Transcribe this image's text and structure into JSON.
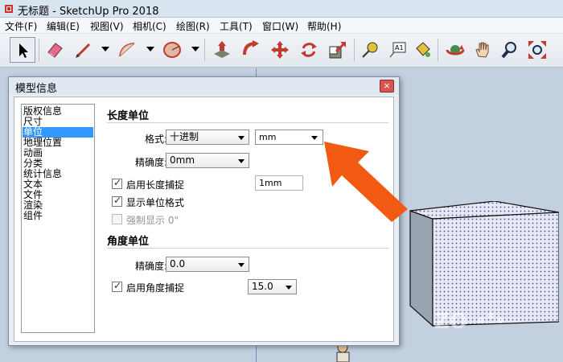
{
  "window": {
    "title": "无标题 - SketchUp Pro 2018"
  },
  "menu": [
    {
      "label": "文件(F)"
    },
    {
      "label": "编辑(E)"
    },
    {
      "label": "视图(V)"
    },
    {
      "label": "相机(C)"
    },
    {
      "label": "绘图(R)"
    },
    {
      "label": "工具(T)"
    },
    {
      "label": "窗口(W)"
    },
    {
      "label": "帮助(H)"
    }
  ],
  "toolbar": {
    "tools": [
      "select-icon",
      "eraser-icon",
      "pencil-line-icon",
      "arc-icon",
      "circle-icon",
      "push-pull-icon",
      "follow-me-icon",
      "move-icon",
      "rotate-icon",
      "scale-icon",
      "tape-measure-icon",
      "text-icon",
      "paint-bucket-icon",
      "orbit-icon",
      "pan-icon",
      "zoom-icon",
      "zoom-extents-icon"
    ]
  },
  "dialog": {
    "title": "模型信息",
    "close_label": "×",
    "nav": [
      {
        "label": "版权信息"
      },
      {
        "label": "尺寸"
      },
      {
        "label": "单位",
        "active": true
      },
      {
        "label": "地理位置"
      },
      {
        "label": "动画"
      },
      {
        "label": "分类"
      },
      {
        "label": "统计信息"
      },
      {
        "label": "文本"
      },
      {
        "label": "文件"
      },
      {
        "label": "渲染"
      },
      {
        "label": "组件"
      }
    ],
    "length_units": {
      "title": "长度单位",
      "format_label": "格式:",
      "format_value": "十进制",
      "unit_value": "mm",
      "precision_label": "精确度:",
      "precision_value": "0mm",
      "snap_label": "启用长度捕捉",
      "snap_checked": true,
      "snap_value": "1mm",
      "show_format_label": "显示单位格式",
      "show_format_checked": true,
      "force_display_label": "强制显示 0\"",
      "force_display_checked": false,
      "force_display_enabled": false
    },
    "angle_units": {
      "title": "角度单位",
      "precision_label": "精确度:",
      "precision_value": "0.0",
      "snap_label": "启用角度捕捉",
      "snap_checked": true,
      "snap_value": "15.0"
    }
  },
  "annotation": {
    "arrow_color": "#f25a14"
  },
  "watermark": {
    "text": "ZO"
  }
}
